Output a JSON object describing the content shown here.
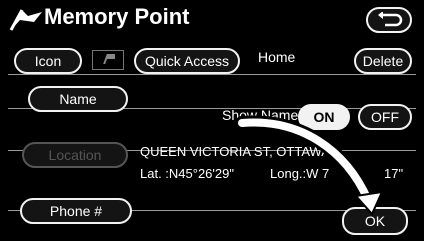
{
  "header": {
    "title": "Memory Point",
    "flag_icon": "flag-icon",
    "back_icon": "return-arrow-icon"
  },
  "icon_row": {
    "icon_label": "Icon",
    "quick_access_label": "Quick Access",
    "name_value": "Home",
    "delete_label": "Delete"
  },
  "name_row": {
    "name_label": "Name",
    "show_name_label": "Show Name",
    "on_label": "ON",
    "off_label": "OFF",
    "on_selected": true
  },
  "location_row": {
    "location_label": "Location",
    "address": "QUEEN VICTORIA ST, OTTAWA,",
    "lat": "Lat. :N45°26'29\"",
    "long": "Long.:W 7",
    "long_tail": "17\""
  },
  "phone_row": {
    "phone_label": "Phone #"
  },
  "footer": {
    "ok_label": "OK"
  },
  "colors": {
    "background": "#000000",
    "button_border": "#f2f2f2",
    "separator": "#9a9a9a"
  }
}
